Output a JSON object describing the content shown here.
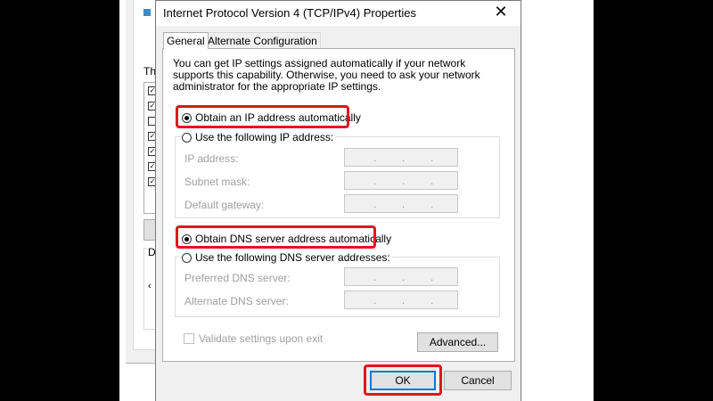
{
  "dialog": {
    "title": "Internet Protocol Version 4 (TCP/IPv4) Properties",
    "close_glyph": "✕"
  },
  "tabs": [
    {
      "label": "General",
      "selected": true
    },
    {
      "label": "Alternate Configuration",
      "selected": false
    }
  ],
  "description": "You can get IP settings assigned automatically if your network supports this capability. Otherwise, you need to ask your network administrator for the appropriate IP settings.",
  "ip_section": {
    "auto_label": "Obtain an IP address automatically",
    "manual_label": "Use the following IP address:",
    "selected": "auto",
    "fields": [
      {
        "label": "IP address:",
        "value": ""
      },
      {
        "label": "Subnet mask:",
        "value": ""
      },
      {
        "label": "Default gateway:",
        "value": ""
      }
    ]
  },
  "dns_section": {
    "auto_label": "Obtain DNS server address automatically",
    "manual_label": "Use the following DNS server addresses:",
    "selected": "auto",
    "fields": [
      {
        "label": "Preferred DNS server:",
        "value": ""
      },
      {
        "label": "Alternate DNS server:",
        "value": ""
      }
    ]
  },
  "validate_label": "Validate settings upon exit",
  "buttons": {
    "advanced": "Advanced...",
    "ok": "OK",
    "cancel": "Cancel"
  },
  "background_window": {
    "partial_label_1": "Th",
    "partial_label_2": "D"
  },
  "colors": {
    "highlight": "#e2141d",
    "ok_focus": "#0078d7"
  }
}
